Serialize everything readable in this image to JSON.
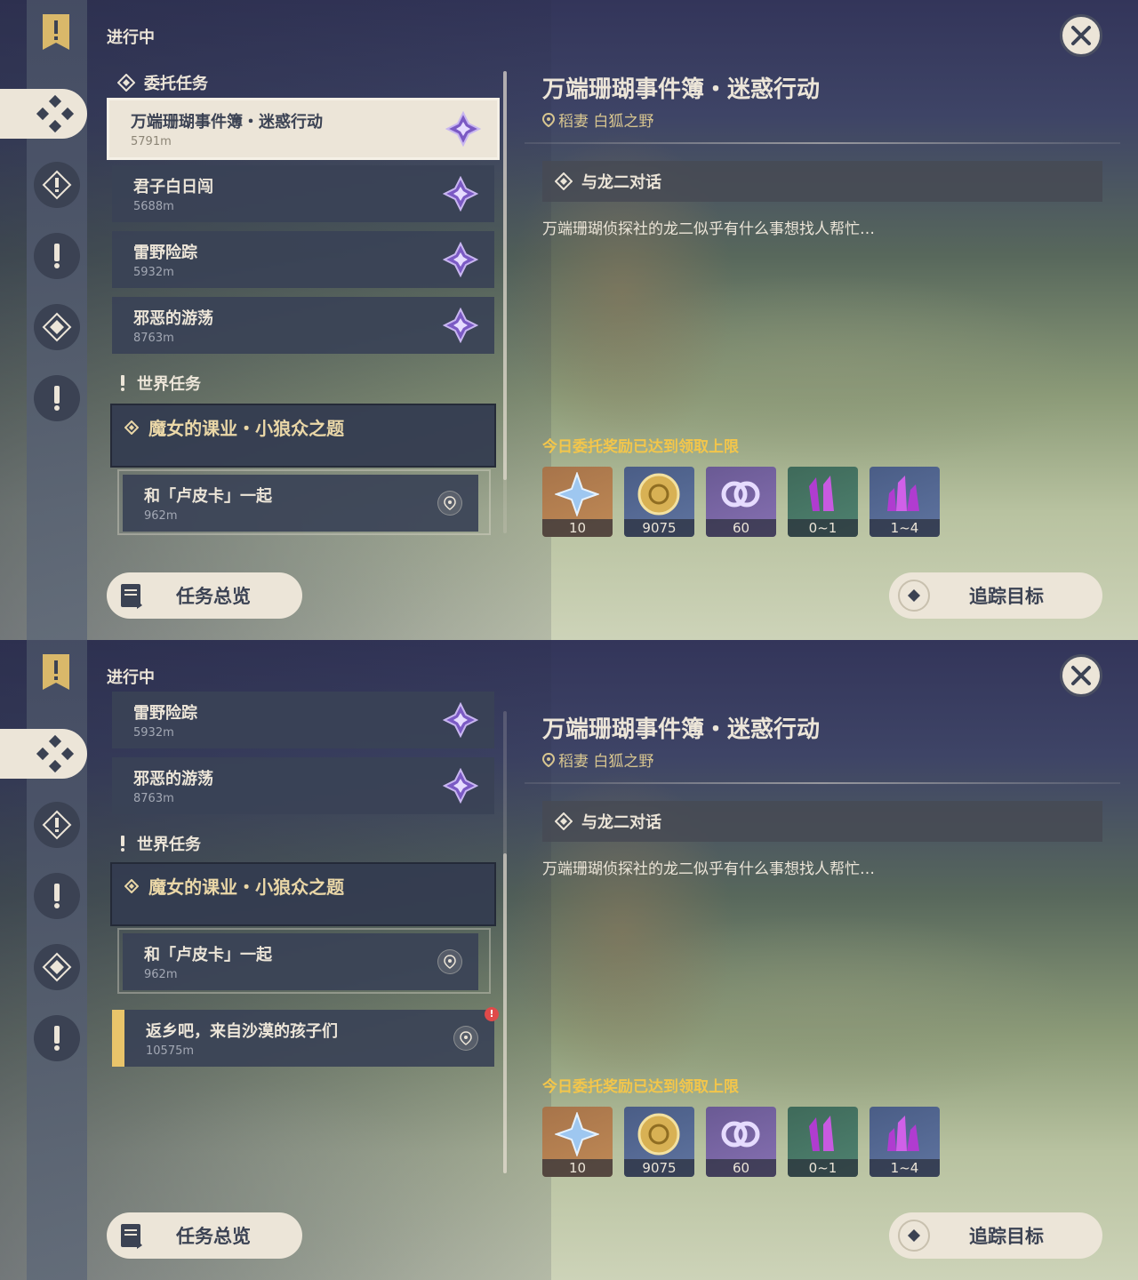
{
  "header": {
    "in_progress": "进行中"
  },
  "panel1": {
    "commission_section": "委托任务",
    "commissions": [
      {
        "title": "万端珊瑚事件簿・迷惑行动",
        "distance": "5791m",
        "selected": true
      },
      {
        "title": "君子白日闯",
        "distance": "5688m"
      },
      {
        "title": "雷野险踪",
        "distance": "5932m"
      },
      {
        "title": "邪恶的游荡",
        "distance": "8763m"
      }
    ],
    "world_section": "世界任务",
    "world_quest": {
      "title": "魔女的课业・小狼众之题"
    },
    "sub_quest": {
      "title": "和「卢皮卡」一起",
      "distance": "962m"
    }
  },
  "panel2": {
    "commissions": [
      {
        "title": "雷野险踪",
        "distance": "5932m"
      },
      {
        "title": "邪恶的游荡",
        "distance": "8763m"
      }
    ],
    "world_section": "世界任务",
    "world_quest": {
      "title": "魔女的课业・小狼众之题"
    },
    "sub_quest": {
      "title": "和「卢皮卡」一起",
      "distance": "962m"
    },
    "extra_quest": {
      "title": "返乡吧，来自沙漠的孩子们",
      "distance": "10575m",
      "alert": "!"
    }
  },
  "detail": {
    "title": "万端珊瑚事件簿・迷惑行动",
    "location": "稻妻 白狐之野",
    "objective": "与龙二对话",
    "description": "万端珊瑚侦探社的龙二似乎有什么事想找人帮忙…",
    "reward_limit": "今日委托奖励已达到领取上限",
    "rewards": [
      {
        "icon": "primogem-icon",
        "count": "10"
      },
      {
        "icon": "mora-icon",
        "count": "9075"
      },
      {
        "icon": "friendship-exp-icon",
        "count": "60"
      },
      {
        "icon": "crystal-small-icon",
        "count": "0~1"
      },
      {
        "icon": "crystal-large-icon",
        "count": "1~4"
      }
    ]
  },
  "buttons": {
    "overview": "任务总览",
    "track": "追踪目标"
  },
  "colors": {
    "cream": "#ece5d8",
    "gold": "#f3c64b",
    "panel": "#3a4256"
  }
}
